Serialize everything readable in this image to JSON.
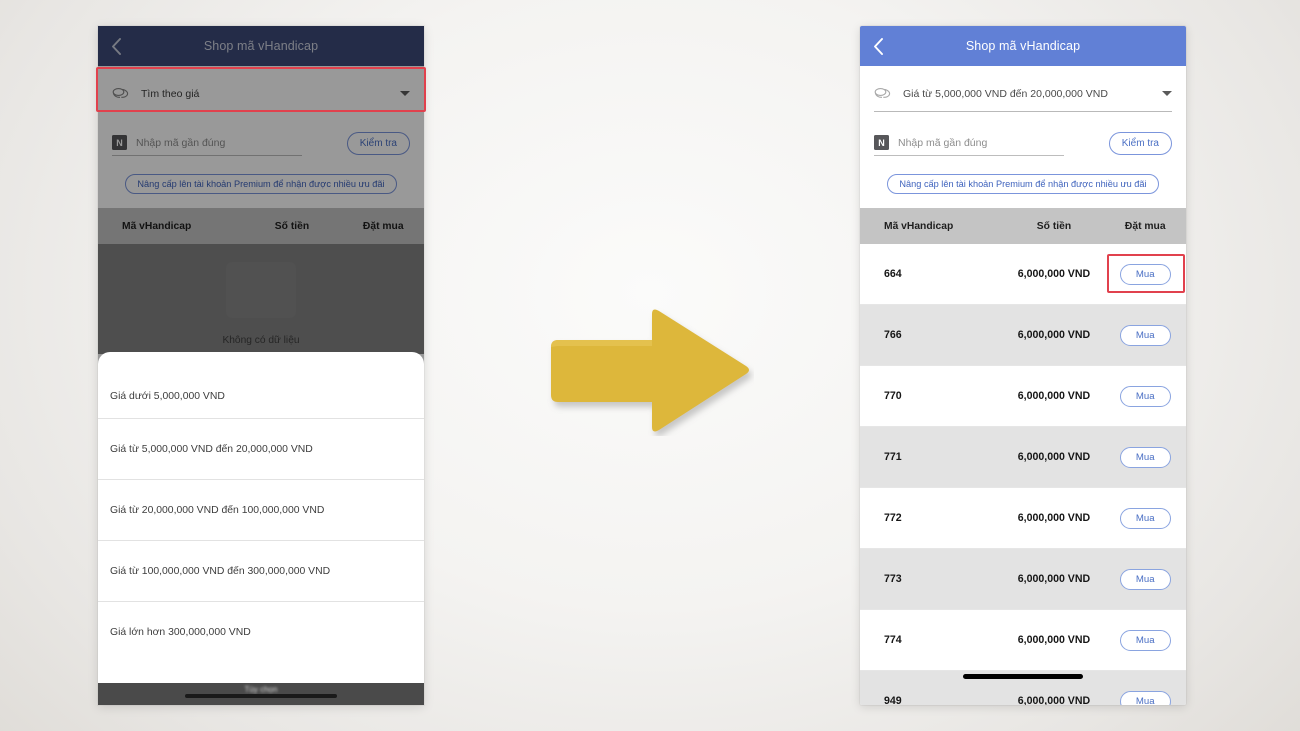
{
  "app": {
    "header_title": "Shop mã vHandicap",
    "back_icon": "chevron-left-icon",
    "accent_blue": "#6180d6",
    "dimmed_blue": "#3c4a78",
    "highlight_red": "#e1414d",
    "arrow_yellow": "#ddb73a"
  },
  "left_phone": {
    "header_title": "Shop mã vHandicap",
    "filter": {
      "icon": "money-stack-icon",
      "value": "Tìm theo giá",
      "caret_icon": "caret-down-icon"
    },
    "code_entry": {
      "badge": "N",
      "placeholder": "Nhập mã gần đúng",
      "check_label": "Kiểm tra"
    },
    "premium_label": "Nâng cấp lên tài khoản Premium để nhận được nhiều ưu đãi",
    "table_headers": [
      "Mã vHandicap",
      "Số tiền",
      "Đặt mua"
    ],
    "empty_text": "Không có dữ liệu",
    "sheet_options": [
      "Giá dưới 5,000,000 VND",
      "Giá từ 5,000,000 VND đến 20,000,000 VND",
      "Giá từ 20,000,000 VND đến 100,000,000 VND",
      "Giá từ 100,000,000 VND đến 300,000,000 VND",
      "Giá lớn hơn 300,000,000 VND"
    ],
    "nav_bar_label": "Tùy chọn"
  },
  "right_phone": {
    "header_title": "Shop mã vHandicap",
    "filter": {
      "icon": "money-stack-icon",
      "value": "Giá từ 5,000,000 VND đến 20,000,000 VND",
      "caret_icon": "caret-down-icon"
    },
    "code_entry": {
      "badge": "N",
      "placeholder": "Nhập mã gần đúng",
      "check_label": "Kiểm tra"
    },
    "premium_label": "Nâng cấp lên tài khoản Premium để nhận được nhiều ưu đãi",
    "table_headers": [
      "Mã vHandicap",
      "Số tiền",
      "Đặt mua"
    ],
    "buy_label": "Mua",
    "rows": [
      {
        "code": "664",
        "amount": "6,000,000 VND",
        "buy": "Mua"
      },
      {
        "code": "766",
        "amount": "6,000,000 VND",
        "buy": "Mua"
      },
      {
        "code": "770",
        "amount": "6,000,000 VND",
        "buy": "Mua"
      },
      {
        "code": "771",
        "amount": "6,000,000 VND",
        "buy": "Mua"
      },
      {
        "code": "772",
        "amount": "6,000,000 VND",
        "buy": "Mua"
      },
      {
        "code": "773",
        "amount": "6,000,000 VND",
        "buy": "Mua"
      },
      {
        "code": "774",
        "amount": "6,000,000 VND",
        "buy": "Mua"
      },
      {
        "code": "949",
        "amount": "6,000,000 VND",
        "buy": "Mua"
      }
    ]
  },
  "annotation": {
    "arrow_icon": "right-arrow-icon",
    "highlight_1": "filter-dropdown-highlight",
    "highlight_2": "buy-button-highlight"
  }
}
